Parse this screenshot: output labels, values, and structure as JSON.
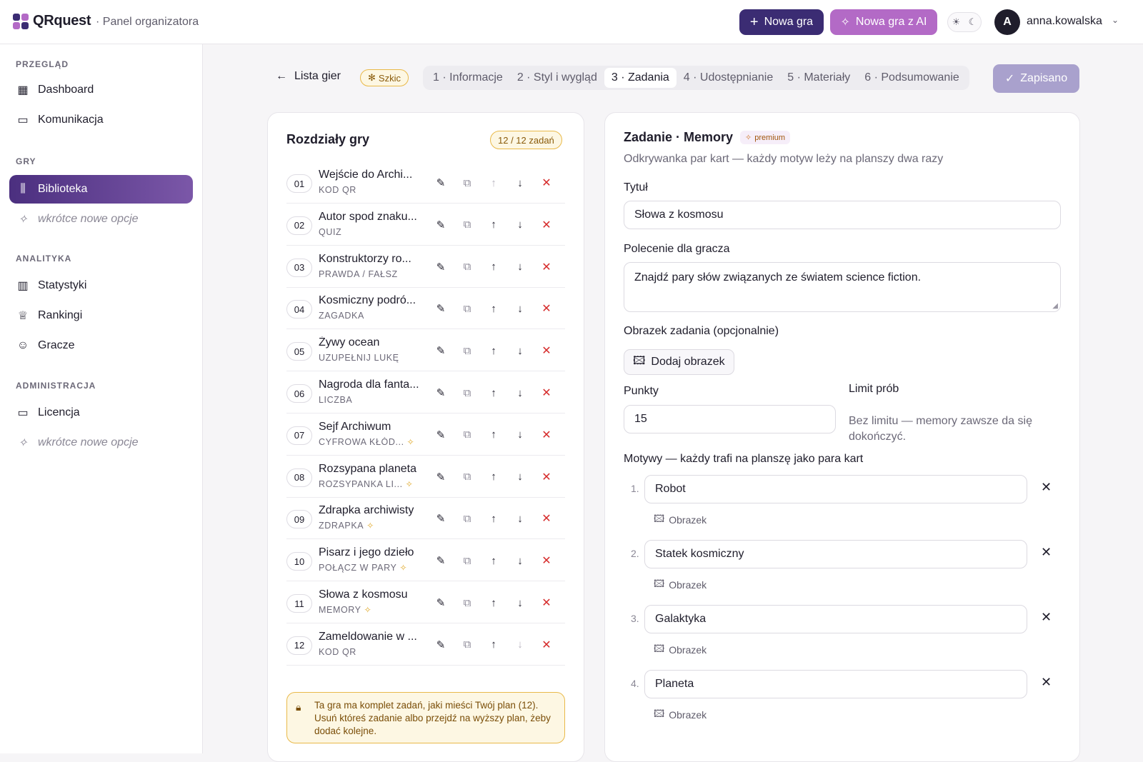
{
  "header": {
    "brand": "QRquest",
    "panel_label": "· Panel organizatora",
    "new_game": "Nowa gra",
    "new_game_ai": "Nowa gra z AI",
    "avatar_initial": "A",
    "username": "anna.kowalska",
    "colors": {
      "primary": "#3b2c73",
      "ai": "#b36ac6"
    }
  },
  "sidebar": {
    "sections": [
      {
        "title": "PRZEGLĄD",
        "items": [
          {
            "label": "Dashboard",
            "icon": "dashboard-icon"
          },
          {
            "label": "Komunikacja",
            "icon": "chat-icon"
          }
        ]
      },
      {
        "title": "GRY",
        "items": [
          {
            "label": "Biblioteka",
            "icon": "library-icon",
            "active": true
          },
          {
            "label": "wkrótce nowe opcje",
            "icon": "sparkle-icon"
          }
        ]
      },
      {
        "title": "ANALITYKA",
        "items": [
          {
            "label": "Statystyki",
            "icon": "bar-chart-icon"
          },
          {
            "label": "Rankingi",
            "icon": "trophy-icon"
          },
          {
            "label": "Gracze",
            "icon": "users-icon"
          }
        ]
      },
      {
        "title": "ADMINISTRACJA",
        "items": [
          {
            "label": "Licencja",
            "icon": "card-icon"
          },
          {
            "label": "wkrótce nowe opcje",
            "icon": "sparkle-icon"
          }
        ]
      }
    ]
  },
  "wizard": {
    "back": "Lista gier",
    "status": "Szkic",
    "steps": [
      "1 · Informacje",
      "2 · Styl i wygląd",
      "3 · Zadania",
      "4 · Udostępnianie",
      "5 · Materiały",
      "6 · Podsumowanie"
    ],
    "active_step": 3,
    "saved": "Zapisano"
  },
  "chapters": {
    "title": "Rozdziały gry",
    "count": "12 / 12 zadań",
    "tasks": [
      {
        "num": "01",
        "title": "Wejście do Archi...",
        "type": "KOD QR",
        "premium": false
      },
      {
        "num": "02",
        "title": "Autor spod znaku...",
        "type": "QUIZ",
        "premium": false
      },
      {
        "num": "03",
        "title": "Konstruktorzy ro...",
        "type": "PRAWDA / FAŁSZ",
        "premium": false
      },
      {
        "num": "04",
        "title": "Kosmiczny podró...",
        "type": "ZAGADKA",
        "premium": false
      },
      {
        "num": "05",
        "title": "Żywy ocean",
        "type": "UZUPEŁNIJ LUKĘ",
        "premium": false
      },
      {
        "num": "06",
        "title": "Nagroda dla fanta...",
        "type": "LICZBA",
        "premium": false
      },
      {
        "num": "07",
        "title": "Sejf Archiwum",
        "type": "CYFROWA KŁÓD...",
        "premium": true
      },
      {
        "num": "08",
        "title": "Rozsypana planeta",
        "type": "ROZSYPANKA LI...",
        "premium": true
      },
      {
        "num": "09",
        "title": "Zdrapka archiwisty",
        "type": "ZDRAPKA",
        "premium": true
      },
      {
        "num": "10",
        "title": "Pisarz i jego dzieło",
        "type": "POŁĄCZ W PARY",
        "premium": true
      },
      {
        "num": "11",
        "title": "Słowa z kosmosu",
        "type": "MEMORY",
        "premium": true
      },
      {
        "num": "12",
        "title": "Zameldowanie w ...",
        "type": "KOD QR",
        "premium": false
      }
    ],
    "plan_note": "Ta gra ma komplet zadań, jaki mieści Twój plan (12). Usuń któreś zadanie albo przejdź na wyższy plan, żeby dodać kolejne."
  },
  "editor": {
    "title": "Zadanie · Memory",
    "premium": "premium",
    "subtitle": "Odkrywanka par kart — każdy motyw leży na planszy dwa razy",
    "title_label": "Tytuł",
    "title_value": "Słowa z kosmosu",
    "prompt_label": "Polecenie dla gracza",
    "prompt_value": "Znajdź pary słów związanych ze światem science fiction.",
    "image_label": "Obrazek zadania (opcjonalnie)",
    "add_image": "Dodaj obrazek",
    "points_label": "Punkty",
    "points_value": "15",
    "limit_label": "Limit prób",
    "limit_desc": "Bez limitu — memory zawsze da się dokończyć.",
    "motifs_label": "Motywy — każdy trafi na planszę jako para kart",
    "motifs": [
      {
        "num": "1.",
        "value": "Robot",
        "image": "Obrazek"
      },
      {
        "num": "2.",
        "value": "Statek kosmiczny",
        "image": "Obrazek"
      },
      {
        "num": "3.",
        "value": "Galaktyka",
        "image": "Obrazek"
      },
      {
        "num": "4.",
        "value": "Planeta",
        "image": "Obrazek"
      }
    ]
  }
}
